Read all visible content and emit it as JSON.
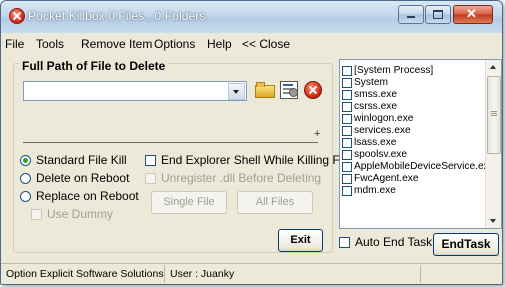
{
  "window": {
    "title": "Pocket Killbox  0 Files , 0 Folders",
    "icon": "killbox-app-icon"
  },
  "menu": [
    "File",
    "Tools",
    "Remove Item",
    "Options",
    "Help",
    "<< Close"
  ],
  "path_group": {
    "title": "Full Path of File to Delete",
    "path_value": "",
    "plus_glyph": "+"
  },
  "options": {
    "standard_kill": "Standard File Kill",
    "delete_on_reboot": "Delete on Reboot",
    "replace_on_reboot": "Replace on Reboot",
    "use_dummy": "Use Dummy",
    "end_explorer": "End Explorer Shell While Killing File",
    "unregister_dll": "Unregister .dll Before Deleting",
    "selected": "standard_kill"
  },
  "buttons": {
    "single_file": "Single File",
    "all_files": "All Files",
    "exit": "Exit",
    "end_task": "EndTask"
  },
  "process_list": [
    "[System Process]",
    "System",
    "smss.exe",
    "csrss.exe",
    "winlogon.exe",
    "services.exe",
    "lsass.exe",
    "spoolsv.exe",
    "AppleMobileDeviceService.exe",
    "FwcAgent.exe",
    "mdm.exe"
  ],
  "auto_end_task": "Auto End Task",
  "status": {
    "company": "Option Explicit Software Solutions",
    "user": "User : Juanky"
  },
  "colors": {
    "window_bg": "#ece9d8",
    "titlebar": "#c3d7ec",
    "radio_selected": "#2ba32b",
    "close_button": "#d55d45"
  }
}
